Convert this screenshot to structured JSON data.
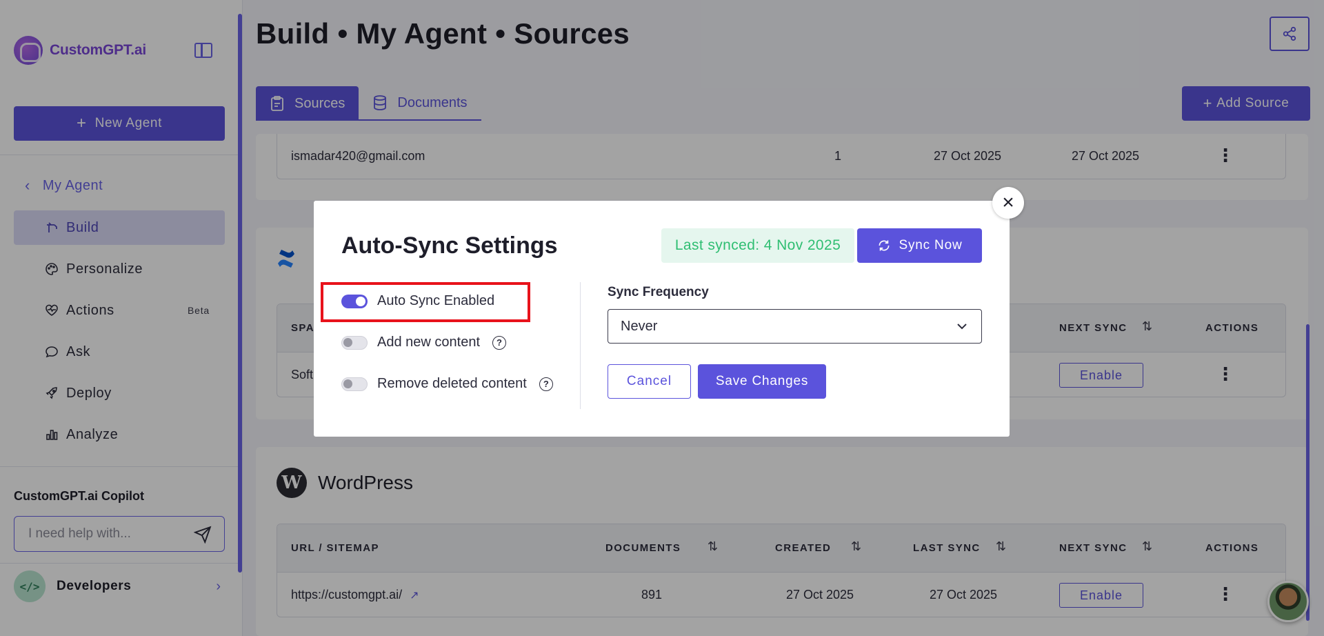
{
  "sidebar": {
    "brand": "CustomGPT.ai",
    "new_agent_label": "New Agent",
    "back_label": "My Agent",
    "items": [
      {
        "label": "Build",
        "icon": "build-icon",
        "active": true
      },
      {
        "label": "Personalize",
        "icon": "palette-icon"
      },
      {
        "label": "Actions",
        "icon": "heart-pulse-icon",
        "badge": "Beta"
      },
      {
        "label": "Ask",
        "icon": "chat-bubble-icon"
      },
      {
        "label": "Deploy",
        "icon": "rocket-icon"
      },
      {
        "label": "Analyze",
        "icon": "bar-chart-icon"
      }
    ],
    "copilot_title": "CustomGPT.ai Copilot",
    "copilot_placeholder": "I need help with...",
    "developers_label": "Developers",
    "accent": "#5b53dc"
  },
  "header": {
    "title": "Build • My Agent • Sources",
    "tabs": [
      {
        "label": "Sources",
        "active": true
      },
      {
        "label": "Documents",
        "active": false
      }
    ],
    "add_source_label": "Add Source"
  },
  "email_card": {
    "row": {
      "name": "ismadar420@gmail.com",
      "documents": "1",
      "created": "27 Oct 2025",
      "last_sync": "27 Oct 2025"
    }
  },
  "confluence_card": {
    "header_partial": "SPA",
    "next_sync_header": "NEXT SYNC",
    "actions_header": "ACTIONS",
    "row_partial": "Soft",
    "enable_label": "Enable"
  },
  "wordpress_card": {
    "title": "WordPress",
    "columns": [
      "URL / SITEMAP",
      "DOCUMENTS",
      "CREATED",
      "LAST SYNC",
      "NEXT SYNC",
      "ACTIONS"
    ],
    "row": {
      "url": "https://customgpt.ai/",
      "documents": "891",
      "created": "27 Oct 2025",
      "last_sync": "27 Oct 2025",
      "enable_label": "Enable"
    }
  },
  "modal": {
    "title": "Auto-Sync Settings",
    "last_synced": "Last synced: 4 Nov 2025",
    "sync_now_label": "Sync Now",
    "toggles": [
      {
        "label": "Auto Sync Enabled",
        "on": true,
        "help": false
      },
      {
        "label": "Add new content",
        "on": false,
        "help": true
      },
      {
        "label": "Remove deleted content",
        "on": false,
        "help": true
      }
    ],
    "frequency_label": "Sync Frequency",
    "frequency_value": "Never",
    "cancel_label": "Cancel",
    "save_label": "Save Changes",
    "success_color": "#2fbe72",
    "highlight_color": "#e8121b"
  }
}
